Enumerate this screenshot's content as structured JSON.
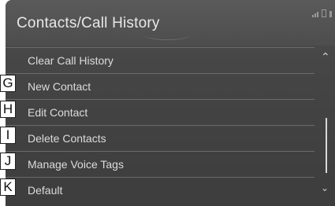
{
  "header": {
    "title": "Contacts/Call History"
  },
  "menu": {
    "items": [
      {
        "label": "Clear Call History"
      },
      {
        "label": "New Contact",
        "marker": "G"
      },
      {
        "label": "Edit Contact",
        "marker": "H"
      },
      {
        "label": "Delete Contacts",
        "marker": "I"
      },
      {
        "label": "Manage Voice Tags",
        "marker": "J"
      },
      {
        "label": "Default",
        "marker": "K"
      }
    ]
  },
  "scrollbar": {
    "up_icon": "chevron-up-icon",
    "down_icon": "chevron-down-icon"
  },
  "colors": {
    "screen_bg": "#444444",
    "text": "#dcdcdc",
    "divider": "#6b6b6b"
  }
}
